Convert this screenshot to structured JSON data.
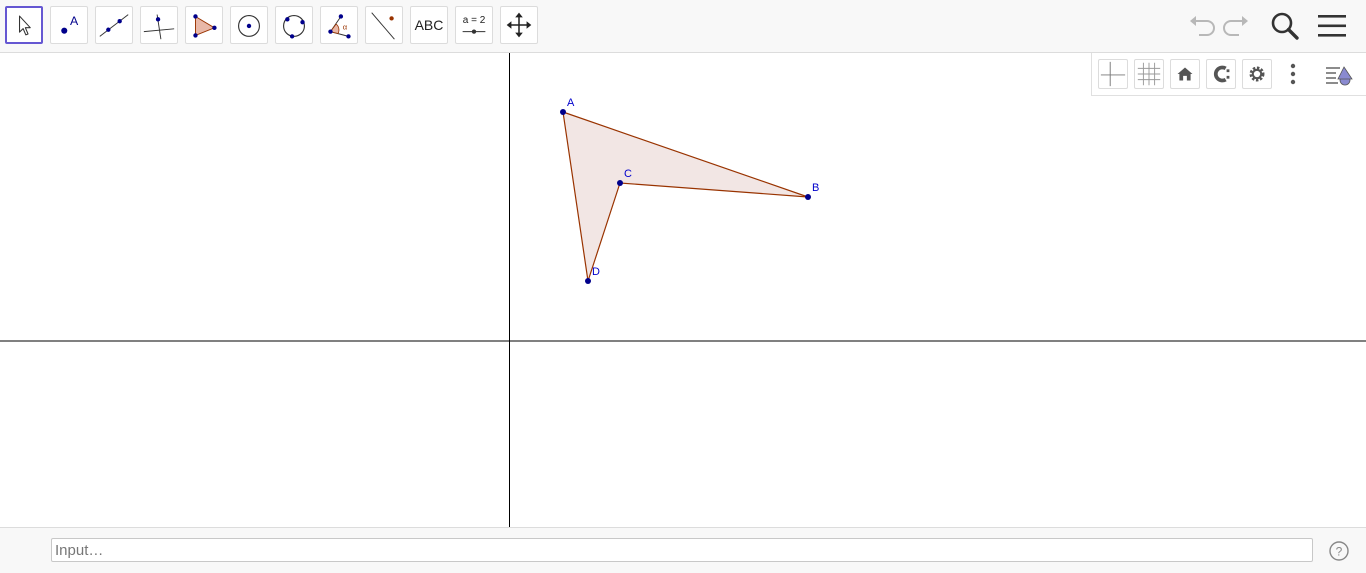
{
  "toolbar": {
    "tools": [
      {
        "name": "Move",
        "icon": "move-arrow-icon"
      },
      {
        "name": "Point",
        "icon": "point-icon",
        "label": "A"
      },
      {
        "name": "Line",
        "icon": "line-icon"
      },
      {
        "name": "Perpendicular Line",
        "icon": "perpendicular-line-icon"
      },
      {
        "name": "Polygon",
        "icon": "polygon-icon"
      },
      {
        "name": "Circle with Center through Point",
        "icon": "circle-center-icon"
      },
      {
        "name": "Circle through 3 Points",
        "icon": "circle-3points-icon"
      },
      {
        "name": "Angle",
        "icon": "angle-icon",
        "label": "α"
      },
      {
        "name": "Reflect about Line",
        "icon": "reflect-icon"
      },
      {
        "name": "Text",
        "icon": "text-icon",
        "label": "ABC"
      },
      {
        "name": "Slider",
        "icon": "slider-icon",
        "label": "a = 2"
      },
      {
        "name": "Move Graphics View",
        "icon": "move-view-icon"
      }
    ],
    "undo_icon": "undo-icon",
    "redo_icon": "redo-icon",
    "search_icon": "search-icon",
    "menu_icon": "hamburger-menu-icon"
  },
  "style_bar": {
    "buttons": [
      "axes-icon",
      "grid-icon",
      "home-icon",
      "point-capturing-icon",
      "gear-icon",
      "more-vertical-icon",
      "style-bar-toggle-icon"
    ]
  },
  "colors": {
    "accent": "#6557d2",
    "point": "#00008b",
    "polygon_stroke": "#993300",
    "polygon_fill": "#f2e6e4",
    "axis": "#000000",
    "point_label": "#0000cc"
  },
  "graphics": {
    "axes": true,
    "grid": false,
    "points": [
      {
        "label": "A"
      },
      {
        "label": "B"
      },
      {
        "label": "C"
      },
      {
        "label": "D"
      }
    ],
    "polygon": {
      "vertices": [
        "A",
        "B",
        "C",
        "D"
      ]
    }
  },
  "input_bar": {
    "placeholder": "Input…",
    "value": "",
    "help_icon": "help-icon"
  }
}
